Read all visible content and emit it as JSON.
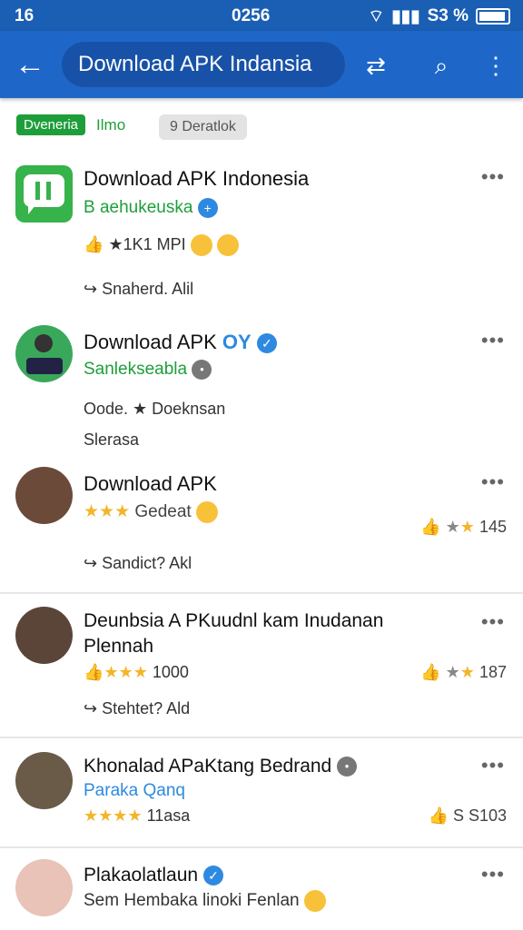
{
  "status": {
    "left": "16",
    "center": "0256",
    "right": "S3 %"
  },
  "appbar": {
    "search_text": "Download APK Indansia"
  },
  "chips": {
    "green_label": "Dveneria",
    "green_text": "Ilmo",
    "gray_label": "9 Deratlok"
  },
  "items": [
    {
      "title": "Download APK Indonesia",
      "sub": "B aehukeuska",
      "meta1": "★1K1 MPI",
      "meta2": "Snaherd. Alil"
    },
    {
      "title": "Download APK",
      "title_extra": "OY",
      "sub": "Sanlekseabla",
      "meta1": "Oode. ★ Doeknsan",
      "meta2": "Slerasa"
    },
    {
      "title": "Download APK",
      "sub": "Gedeat",
      "right": "145",
      "meta2": "Sandict? Akl"
    },
    {
      "title": "Deunbsia A PKuudnl kam Inudanan",
      "title2": "Plennah",
      "meta1": "1000",
      "right": "187",
      "meta2": "Stehtet? Ald"
    },
    {
      "title": "Khonalad APaKtang Bedrand",
      "sub": "Paraka Qanq",
      "meta1": "11asa",
      "right": "S S103"
    },
    {
      "title": "Plakaolatlaun",
      "sub": "Sem Hembaka linoki Fenlan"
    }
  ]
}
